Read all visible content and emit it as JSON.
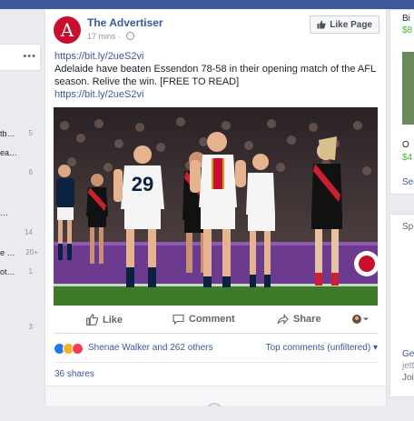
{
  "left_sidebar": {
    "more_label": "•••",
    "items": [
      {
        "label": "tb…",
        "count": "5"
      },
      {
        "label": "ea…",
        "count": ""
      },
      {
        "label": "",
        "count": "6"
      },
      {
        "label": "…",
        "count": ""
      },
      {
        "label": "",
        "count": "14"
      },
      {
        "label": "e …",
        "count": "20+"
      },
      {
        "label": "ot…",
        "count": "1"
      },
      {
        "label": "",
        "count": "3"
      }
    ]
  },
  "post": {
    "page_name": "The Advertiser",
    "avatar_letter": "A",
    "timestamp": "17 mins · ",
    "like_page_label": "Like Page",
    "link_1": "https://bit.ly/2ueS2vi",
    "body": "Adelaide have beaten Essendon 78-58 in their opening match of the AFL season. Relive the win. [FREE TO READ]",
    "link_2": "https://bit.ly/2ueS2vi",
    "photo_alt": "Adelaide players celebrating on the field",
    "actions": {
      "like": "Like",
      "comment": "Comment",
      "share": "Share"
    },
    "reactions_text": "Shenae Walker and 262 others",
    "top_comments_label": "Top comments (unfiltered) ▾",
    "shares_text": "36 shares"
  },
  "right_rail": {
    "box1": {
      "title": "Bi",
      "price1": "$8",
      "label2": "O",
      "price2": "$4",
      "see": "See"
    },
    "box2": {
      "title": "Sp",
      "name": "Ge",
      "sub": "jett",
      "join": "Join"
    }
  },
  "colors": {
    "brand_blue": "#3b5998",
    "link_blue": "#385898",
    "advertiser_red": "#c8102e",
    "adelaide_navy": "#0b2240",
    "essendon_red": "#cc2031",
    "price_green": "#42b72a"
  }
}
